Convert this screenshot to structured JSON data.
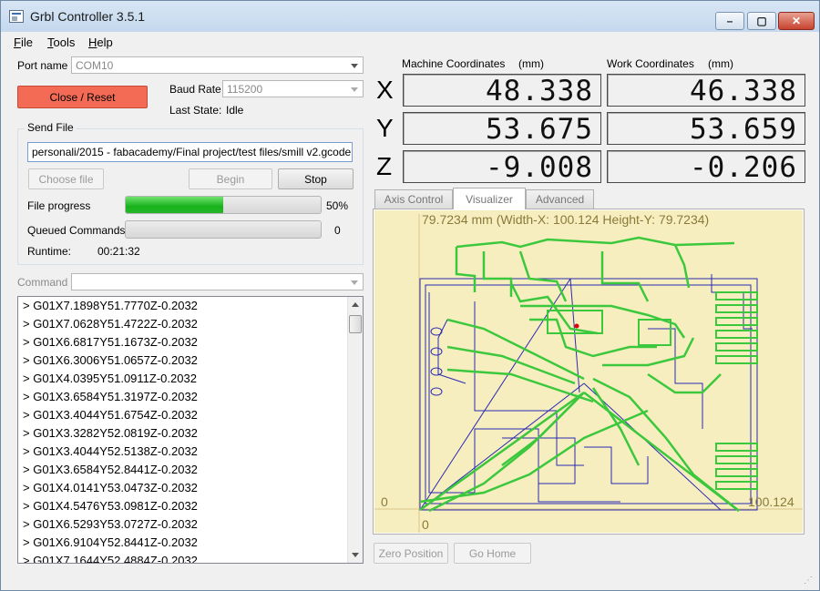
{
  "window": {
    "title": "Grbl Controller 3.5.1",
    "controls": [
      "–",
      "▢",
      "✕"
    ]
  },
  "menu": [
    "File",
    "Tools",
    "Help"
  ],
  "port": {
    "label": "Port name",
    "value": "COM10"
  },
  "close_reset_label": "Close / Reset",
  "baud": {
    "label": "Baud Rate",
    "value": "115200"
  },
  "last_state": {
    "label": "Last State:",
    "value": "Idle"
  },
  "send_file": {
    "group_label": "Send File",
    "path": "personali/2015 - fabacademy/Final project/test files/smill v2.gcode",
    "choose_label": "Choose file",
    "begin_label": "Begin",
    "stop_label": "Stop",
    "progress_label": "File progress",
    "progress_value": 0.5,
    "progress_text": "50%",
    "queued_label": "Queued Commands",
    "queued_value": "0",
    "runtime_label": "Runtime:",
    "runtime_value": "00:21:32"
  },
  "command": {
    "label": "Command",
    "value": ""
  },
  "console_lines": [
    "> G01X7.1898Y51.7770Z-0.2032",
    "> G01X7.0628Y51.4722Z-0.2032",
    "> G01X6.6817Y51.1673Z-0.2032",
    "> G01X6.3006Y51.0657Z-0.2032",
    "> G01X4.0395Y51.0911Z-0.2032",
    "> G01X3.6584Y51.3197Z-0.2032",
    "> G01X3.4044Y51.6754Z-0.2032",
    "> G01X3.3282Y52.0819Z-0.2032",
    "> G01X3.4044Y52.5138Z-0.2032",
    "> G01X3.6584Y52.8441Z-0.2032",
    "> G01X4.0141Y53.0473Z-0.2032",
    "> G01X4.5476Y53.0981Z-0.2032",
    "> G01X6.5293Y53.0727Z-0.2032",
    "> G01X6.9104Y52.8441Z-0.2032",
    "> G01X7.1644Y52.4884Z-0.2032"
  ],
  "coords": {
    "machine_label": "Machine Coordinates",
    "work_label": "Work Coordinates",
    "unit": "(mm)",
    "axes": [
      "X",
      "Y",
      "Z"
    ],
    "machine": [
      "48.338",
      "53.675",
      "-9.008"
    ],
    "work": [
      "46.338",
      "53.659",
      "-0.206"
    ]
  },
  "tabs": [
    "Axis Control",
    "Visualizer",
    "Advanced"
  ],
  "visualizer": {
    "header": "79.7234 mm  (Width-X: 100.124  Height-Y: 79.7234)",
    "x_min": "0",
    "x_max": "100.124",
    "y_min": "0",
    "colors": {
      "background": "#f7eec0",
      "traces": "#3cc83c",
      "rapids": "#2a2ab0",
      "tool": "#e00000"
    }
  },
  "zero_position_label": "Zero Position",
  "go_home_label": "Go Home"
}
